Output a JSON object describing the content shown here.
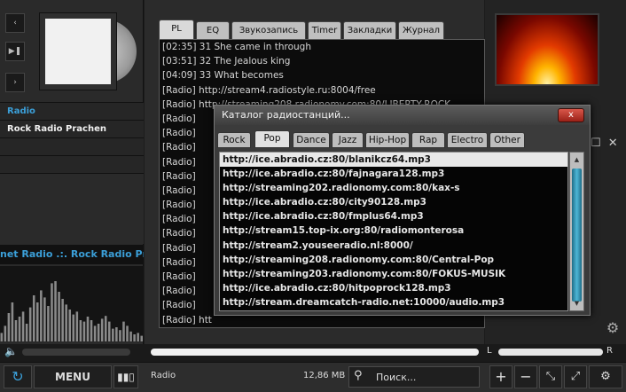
{
  "left": {
    "controls": [
      "‹",
      "▶❚",
      "›"
    ],
    "section_label": "Radio",
    "current_station": "Rock Radio Prachen",
    "marquee": "net Radio .:. Rock Radio Prachen"
  },
  "main": {
    "tabs": [
      "PL",
      "EQ",
      "Звукозапись",
      "Timer",
      "Закладки",
      "Журнал"
    ],
    "playlist": [
      "[02:35] 31 She came in through",
      "[03:51] 32 The Jealous king",
      "[04:09] 33 What becomes",
      "[Radio] http://stream4.radiostyle.ru:8004/free",
      "[Radio] http://streaming208.radionomy.com:80/LIBERTY-ROCK",
      "[Radio]",
      "[Radio]",
      "[Radio]",
      "[Radio]",
      "[Radio]",
      "[Radio]",
      "[Radio]",
      "[Radio]",
      "[Radio]",
      "[Radio]",
      "[Radio]",
      "[Radio]",
      "[Radio]",
      "[Radio]",
      "[Radio] htt"
    ]
  },
  "dialog": {
    "title": "Каталог радиостанций...",
    "close": "x",
    "tabs": [
      "Rock",
      "Pop",
      "Dance",
      "Jazz",
      "Hip-Hop",
      "Rap",
      "Electro",
      "Other"
    ],
    "active_tab": "Pop",
    "urls": [
      "http://ice.abradio.cz:80/blanikcz64.mp3",
      "http://ice.abradio.cz:80/fajnagara128.mp3",
      "http://streaming202.radionomy.com:80/kax-s",
      "http://ice.abradio.cz:80/city90128.mp3",
      "http://ice.abradio.cz:80/fmplus64.mp3",
      "http://stream15.top-ix.org:80/radiomonterosa",
      "http://stream2.youseeradio.nl:8000/",
      "http://streaming208.radionomy.com:80/Central-Pop",
      "http://streaming203.radionomy.com:80/FOKUS-MUSIK",
      "http://ice.abradio.cz:80/hitpoprock128.mp3",
      "http://stream.dreamcatch-radio.net:10000/audio.mp3"
    ]
  },
  "seek": {
    "balance_left": "L",
    "balance_right": "R"
  },
  "bottom": {
    "menu": "MENU",
    "status": "Radio",
    "size": "12,86 MB",
    "search_placeholder": "Поиск...",
    "plus": "+",
    "minus": "−"
  },
  "icons": [
    "repeat-icon",
    "equalizer-icon",
    "search-icon",
    "speaker-icon",
    "fullscreen-icon",
    "shrink-icon",
    "settings-icon",
    "close-icon"
  ],
  "visualizer": {
    "levels": [
      0.12,
      0.22,
      0.4,
      0.55,
      0.3,
      0.35,
      0.42,
      0.25,
      0.48,
      0.65,
      0.55,
      0.72,
      0.62,
      0.5,
      0.82,
      0.85,
      0.7,
      0.6,
      0.52,
      0.45,
      0.38,
      0.42,
      0.3,
      0.28,
      0.35,
      0.3,
      0.22,
      0.25,
      0.32,
      0.36,
      0.28,
      0.18,
      0.2,
      0.16,
      0.28,
      0.22,
      0.14,
      0.1,
      0.12,
      0.08
    ]
  }
}
